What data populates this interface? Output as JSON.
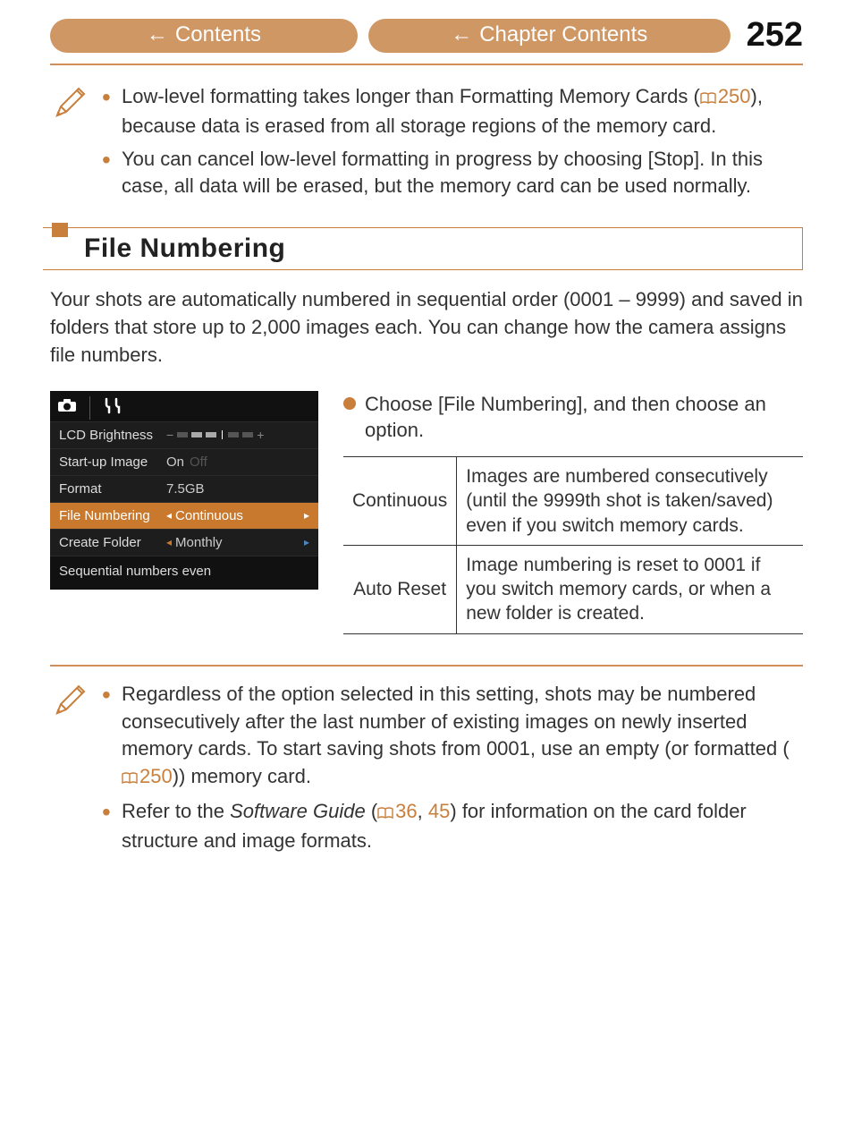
{
  "header": {
    "contents_label": "Contents",
    "chapter_label": "Chapter Contents",
    "page_number": "252"
  },
  "notes_top": {
    "item1_pre": "Low-level formatting takes longer than Formatting Memory Cards (",
    "item1_ref": "250",
    "item1_post": "), because data is erased from all storage regions of the memory card.",
    "item2": "You can cancel low-level formatting in progress by choosing [Stop]. In this case, all data will be erased, but the memory card can be used normally."
  },
  "section_title": "File Numbering",
  "intro": "Your shots are automatically numbered in sequential order (0001 – 9999) and saved in folders that store up to 2,000 images each. You can change how the camera assigns file numbers.",
  "menu": {
    "rows": {
      "brightness_label": "LCD Brightness",
      "startup_label": "Start-up Image",
      "startup_value": "On",
      "startup_off": "Off",
      "format_label": "Format",
      "format_value": "7.5GB",
      "filenum_label": "File Numbering",
      "filenum_value": "Continuous",
      "folder_label": "Create Folder",
      "folder_value": "Monthly"
    },
    "help": "Sequential numbers even"
  },
  "step_text": "Choose [File Numbering], and then choose an option.",
  "table": {
    "r1_name": "Continuous",
    "r1_desc": "Images are numbered consecutively (until the 9999th shot is taken/saved) even if you switch memory cards.",
    "r2_name": "Auto Reset",
    "r2_desc": "Image numbering is reset to 0001 if you switch memory cards, or when a new folder is created."
  },
  "notes_bottom": {
    "item1_pre": "Regardless of the option selected in this setting, shots may be numbered consecutively after the last number of existing images on newly inserted memory cards. To start saving shots from 0001, use an empty (or formatted (",
    "item1_ref": "250",
    "item1_post": ")) memory card.",
    "item2_pre": "Refer to the ",
    "item2_em": "Software Guide",
    "item2_mid": " (",
    "item2_ref1": "36",
    "item2_sep": ", ",
    "item2_ref2": "45",
    "item2_post": ") for information on the card folder structure and image formats."
  }
}
